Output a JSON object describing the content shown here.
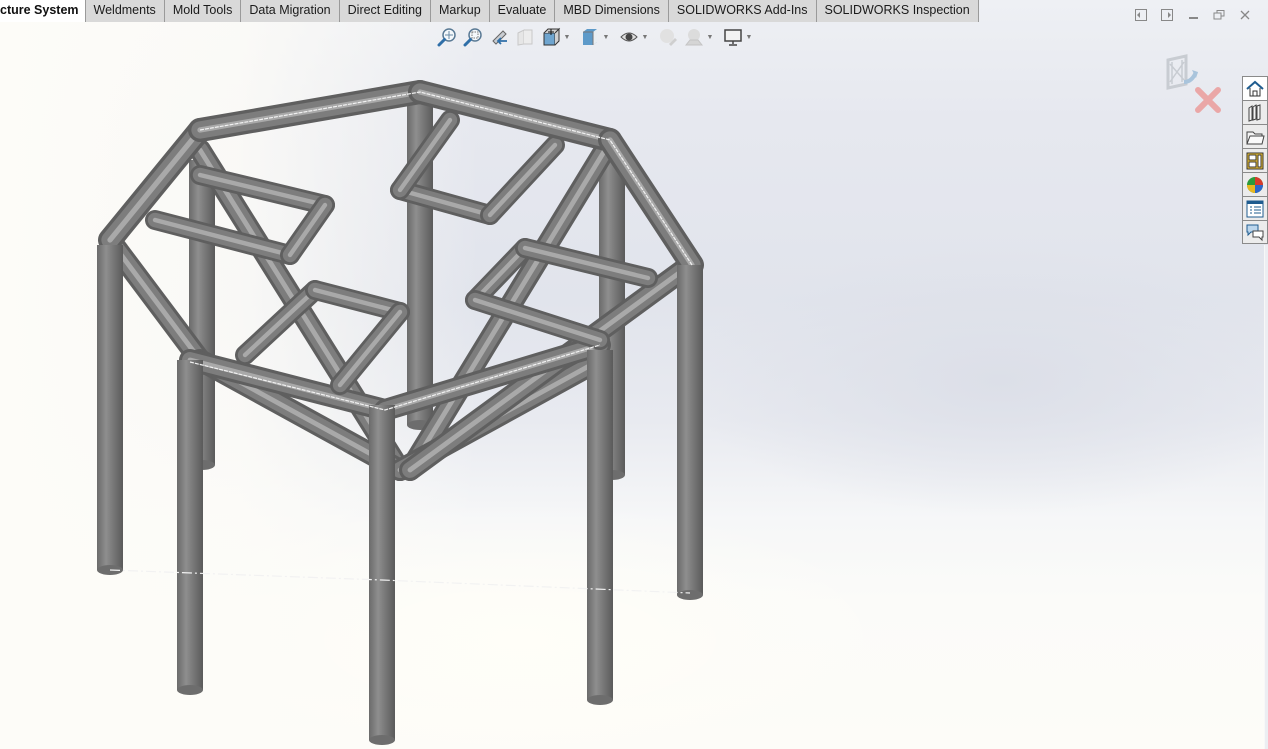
{
  "command_manager": {
    "tabs": [
      {
        "label": "cture System",
        "active": true
      },
      {
        "label": "Weldments",
        "active": false
      },
      {
        "label": "Mold Tools",
        "active": false
      },
      {
        "label": "Data Migration",
        "active": false
      },
      {
        "label": "Direct Editing",
        "active": false
      },
      {
        "label": "Markup",
        "active": false
      },
      {
        "label": "Evaluate",
        "active": false
      },
      {
        "label": "MBD Dimensions",
        "active": false
      },
      {
        "label": "SOLIDWORKS Add-Ins",
        "active": false
      },
      {
        "label": "SOLIDWORKS Inspection",
        "active": false
      }
    ]
  },
  "heads_up_toolbar": {
    "items": [
      {
        "icon": "zoom-to-fit-icon",
        "has_dropdown": false
      },
      {
        "icon": "zoom-to-area-icon",
        "has_dropdown": false
      },
      {
        "icon": "previous-view-icon",
        "has_dropdown": false
      },
      {
        "icon": "section-view-icon",
        "has_dropdown": false
      },
      {
        "icon": "view-orientation-icon",
        "has_dropdown": true
      },
      {
        "icon": "display-style-icon",
        "has_dropdown": true
      },
      {
        "icon": "hide-show-items-icon",
        "has_dropdown": true
      },
      {
        "icon": "edit-appearance-icon",
        "has_dropdown": false
      },
      {
        "icon": "apply-scene-icon",
        "has_dropdown": true
      },
      {
        "icon": "view-settings-icon",
        "has_dropdown": true
      }
    ]
  },
  "window_controls": [
    "restore-left-icon",
    "restore-right-icon",
    "minimize-icon",
    "maximize-icon",
    "close-icon"
  ],
  "confirmation_corner": {
    "exit_sketch": "exit-sketch-icon",
    "cancel": "cancel-icon"
  },
  "task_pane": {
    "tabs": [
      {
        "icon": "home-icon",
        "name": "SOLIDWORKS Resources"
      },
      {
        "icon": "design-library-icon",
        "name": "Design Library"
      },
      {
        "icon": "file-explorer-icon",
        "name": "File Explorer"
      },
      {
        "icon": "view-palette-icon",
        "name": "View Palette"
      },
      {
        "icon": "appearances-icon",
        "name": "Appearances, Scenes, and Decals"
      },
      {
        "icon": "custom-properties-icon",
        "name": "Custom Properties"
      },
      {
        "icon": "forum-icon",
        "name": "SOLIDWORKS Forum"
      }
    ]
  },
  "colors": {
    "tube": "#7d7d7d",
    "tube_light": "#a9a9a9",
    "tube_dark": "#5f5f5f",
    "tab_bg": "#d9d9d9",
    "active_tab_bg": "#ffffff"
  }
}
